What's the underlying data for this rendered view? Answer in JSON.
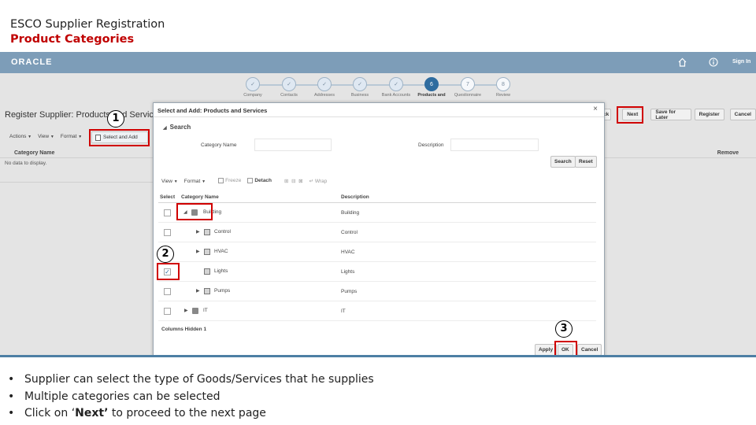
{
  "slide": {
    "title": "ESCO Supplier  Registration",
    "subtitle": "Product Categories"
  },
  "brand": {
    "logo": "ORACLE",
    "signin": "Sign In"
  },
  "train": {
    "steps": [
      {
        "number": "✓",
        "label": "Company",
        "state": "done"
      },
      {
        "number": "✓",
        "label": "Contacts",
        "state": "done"
      },
      {
        "number": "✓",
        "label": "Addresses",
        "state": "done"
      },
      {
        "number": "✓",
        "label": "Business",
        "state": "done"
      },
      {
        "number": "✓",
        "label": "Bank Accounts",
        "state": "done"
      },
      {
        "number": "6",
        "label": "Products and",
        "state": "current"
      },
      {
        "number": "7",
        "label": "Questionnaire",
        "state": "todo"
      },
      {
        "number": "8",
        "label": "Review",
        "state": "todo"
      }
    ]
  },
  "page": {
    "title": "Register Supplier: Products and Services",
    "toolbar": {
      "actions": "Actions",
      "view": "View",
      "format": "Format",
      "select_add": "Select and Add"
    },
    "table_header": "Category Name",
    "no_data": "No data to display.",
    "remove_header": "Remove"
  },
  "buttons": {
    "back": "ck",
    "next": "Next",
    "save_later": "Save for Later",
    "register": "Register",
    "cancel": "Cancel"
  },
  "dialog": {
    "title": "Select and Add: Products and Services",
    "search_header": "Search",
    "category_label": "Category Name",
    "description_label": "Description",
    "search_button": "Search",
    "reset_button": "Reset",
    "toolbar": {
      "view": "View",
      "format": "Format",
      "freeze": "Freeze",
      "detach": "Detach",
      "wrap": "Wrap"
    },
    "columns": {
      "select": "Select",
      "category": "Category Name",
      "description": "Description"
    },
    "rows": [
      {
        "name": "Building",
        "description": "Building",
        "checked": false
      },
      {
        "name": "Control",
        "description": "Control",
        "checked": false
      },
      {
        "name": "HVAC",
        "description": "HVAC",
        "checked": false
      },
      {
        "name": "Lights",
        "description": "Lights",
        "checked": true
      },
      {
        "name": "Pumps",
        "description": "Pumps",
        "checked": false
      },
      {
        "name": "IT",
        "description": "IT",
        "checked": false
      }
    ],
    "columns_hidden": "Columns Hidden  1",
    "apply_button": "Apply",
    "ok_button": "OK",
    "cancel_button": "Cancel"
  },
  "callouts": {
    "one": "1",
    "two": "2",
    "three": "3"
  },
  "notes": {
    "line1": "Supplier can select the type of Goods/Services that he supplies",
    "line2": "Multiple categories can be selected",
    "line3_prefix": "Click on ‘",
    "line3_bold": "Next’",
    "line3_suffix": " to proceed to the next page"
  },
  "colors": {
    "brand_bar": "#7d9db8",
    "callout": "#d00000",
    "current_step": "#2f6c9f"
  }
}
